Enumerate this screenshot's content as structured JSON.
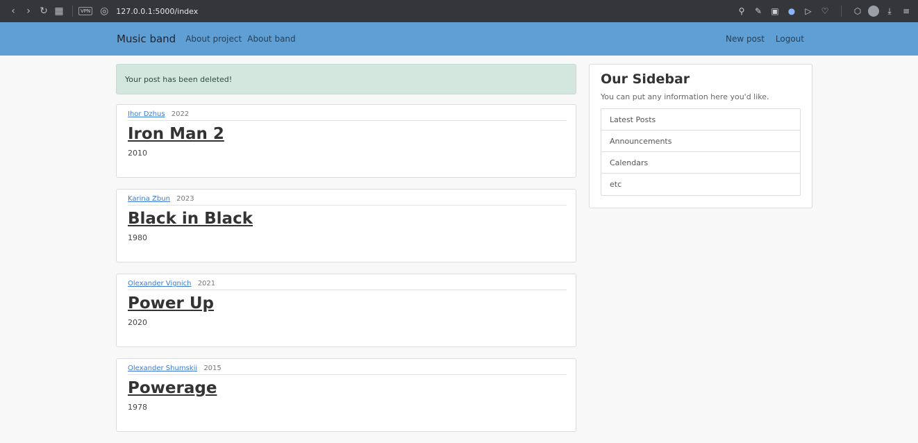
{
  "browser": {
    "vpn_label": "VPN",
    "url": "127.0.0.1:5000/index"
  },
  "navbar": {
    "brand": "Music band",
    "links": [
      "About project",
      "About band"
    ],
    "right_links": [
      "New post",
      "Logout"
    ]
  },
  "alert": "Your post has been deleted!",
  "posts": [
    {
      "author": "Ihor Dzhus",
      "year": "2022",
      "title": "Iron Man 2",
      "body": "2010"
    },
    {
      "author": "Karina Zbun",
      "year": "2023",
      "title": "Black in Black",
      "body": "1980"
    },
    {
      "author": "Olexander Vignich",
      "year": "2021",
      "title": "Power Up",
      "body": "2020"
    },
    {
      "author": "Olexander Shumskii",
      "year": "2015",
      "title": "Powerage",
      "body": "1978"
    }
  ],
  "sidebar": {
    "title": "Our Sidebar",
    "description": "You can put any information here you'd like.",
    "items": [
      "Latest Posts",
      "Announcements",
      "Calendars",
      "etc"
    ]
  }
}
